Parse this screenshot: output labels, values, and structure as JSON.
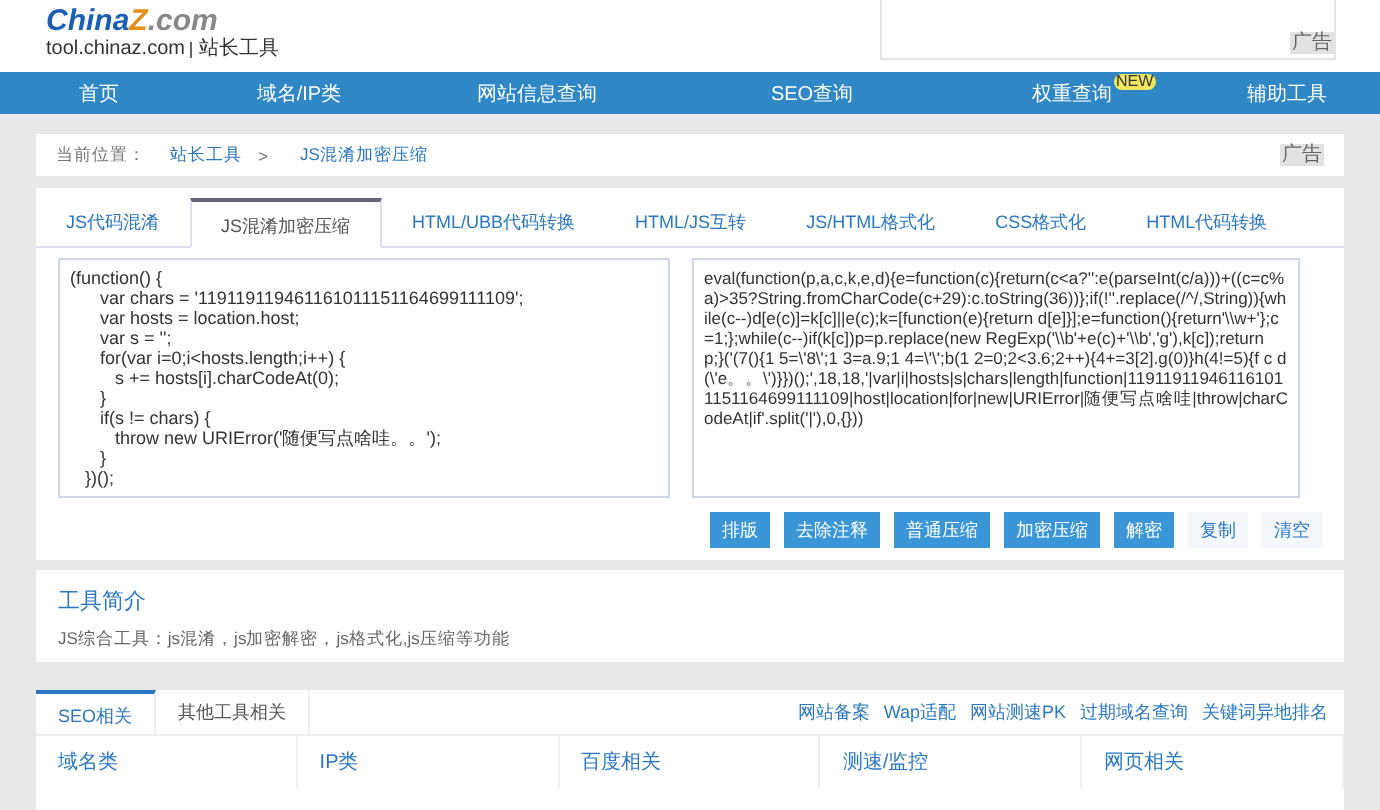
{
  "header": {
    "logo": {
      "brand": "China",
      "brand_accent": "Z",
      "brand_suffix": ".com"
    },
    "site": "tool.chinaz.com",
    "site_name": "站长工具",
    "ad_label": "广告"
  },
  "nav": [
    {
      "label": "首页"
    },
    {
      "label": "域名/IP类"
    },
    {
      "label": "网站信息查询"
    },
    {
      "label": "SEO查询"
    },
    {
      "label": "权重查询",
      "badge": "NEW"
    },
    {
      "label": "辅助工具"
    }
  ],
  "breadcrumb": {
    "prefix": "当前位置：",
    "items": [
      "站长工具",
      "JS混淆加密压缩"
    ],
    "separator": ">",
    "ad_label": "广告"
  },
  "tabs": [
    {
      "label": "JS代码混淆",
      "selected": false
    },
    {
      "label": "JS混淆加密压缩",
      "selected": true
    },
    {
      "label": "HTML/UBB代码转换",
      "selected": false
    },
    {
      "label": "HTML/JS互转",
      "selected": false
    },
    {
      "label": "JS/HTML格式化",
      "selected": false
    },
    {
      "label": "CSS格式化",
      "selected": false
    },
    {
      "label": "HTML代码转换",
      "selected": false
    }
  ],
  "input_code": [
    "(function() {",
    "      var chars = '119119119461161011151164699111109';",
    "      var hosts = location.host;",
    "      var s = '';",
    "      for(var i=0;i<hosts.length;i++) {",
    "         s += hosts[i].charCodeAt(0);",
    "      }",
    "      if(s != chars) {",
    "         throw new URIError('随便写点啥哇。。');",
    "      }",
    "   })();"
  ],
  "output_code": "eval(function(p,a,c,k,e,d){e=function(c){return(c<a?'':e(parseInt(c/a)))+((c=c%a)>35?String.fromCharCode(c+29):c.toString(36))};if(!''.replace(/^/,String)){while(c--)d[e(c)]=k[c]||e(c);k=[function(e){return d[e]}];e=function(){return'\\\\w+'};c=1;};while(c--)if(k[c])p=p.replace(new RegExp('\\\\b'+e(c)+'\\\\b','g'),k[c]);return p;}('(7(){1 5=\\'8\\';1 3=a.9;1 4=\\'\\';b(1 2=0;2<3.6;2++){4+=3[2].g(0)}h(4!=5){f c d(\\'e。。\\')}})();',18,18,'|var|i|hosts|s|chars|length|function|119119119461161011151164699111109|host|location|for|new|URIError|随便写点啥哇|throw|charCodeAt|if'.split('|'),0,{}))",
  "buttons": [
    {
      "label": "排版",
      "kind": "primary"
    },
    {
      "label": "去除注释",
      "kind": "primary"
    },
    {
      "label": "普通压缩",
      "kind": "primary"
    },
    {
      "label": "加密压缩",
      "kind": "primary"
    },
    {
      "label": "解密",
      "kind": "primary"
    },
    {
      "label": "复制",
      "kind": "plain"
    },
    {
      "label": "清空",
      "kind": "plain"
    }
  ],
  "intro": {
    "title": "工具简介",
    "text": "JS综合工具：js混淆，js加密解密，js格式化,js压缩等功能"
  },
  "bottom": {
    "tabs": [
      {
        "label": "SEO相关",
        "selected": true
      },
      {
        "label": "其他工具相关",
        "selected": false
      }
    ],
    "links": [
      "网站备案",
      "Wap适配",
      "网站测速PK",
      "过期域名查询",
      "关键词异地排名"
    ],
    "categories": [
      "域名类",
      "IP类",
      "百度相关",
      "测速/监控",
      "网页相关"
    ]
  }
}
